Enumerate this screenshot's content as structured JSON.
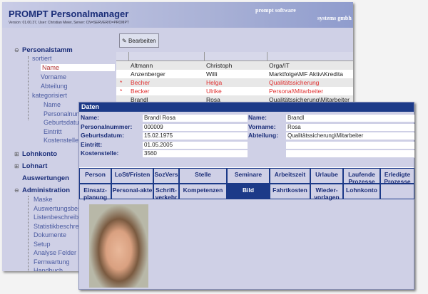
{
  "app": {
    "title": "PROMPT Personalmanager",
    "version": "Version: 01.00.37, User: Christian Meier, Server: CN=SERVER/O=PROMPT",
    "brand_top": "prompt software",
    "brand_bottom": "systems gmbh"
  },
  "sidebar": {
    "personalstamm": "Personalstamm",
    "sortiert": "sortiert",
    "sort_items": [
      "Name",
      "Vorname",
      "Abteilung"
    ],
    "kategorisiert": "kategorisiert",
    "kat_items": [
      "Name",
      "Personalnum",
      "Geburtsdatur",
      "Eintritt",
      "Kostenstelle"
    ],
    "lohnkonto": "Lohnkonto",
    "lohnart": "Lohnart",
    "auswertungen": "Auswertungen",
    "administration": "Administration",
    "admin_items": [
      "Maske",
      "Auswertungsbes",
      "Listenbeschreibu",
      "Statistikbeschreil",
      "Dokumente",
      "Setup",
      "Analyse Felder",
      "Fernwartung",
      "Handbuch"
    ]
  },
  "toolbar": {
    "edit_label": "Bearbeiten"
  },
  "list": {
    "rows": [
      {
        "star": "",
        "name": "Altmann",
        "vorname": "Christoph",
        "abteilung": "Orga/IT",
        "red": false
      },
      {
        "star": "",
        "name": "Anzenberger",
        "vorname": "Willi",
        "abteilung": "Marktfolge\\MF Aktiv\\Kredita",
        "red": false
      },
      {
        "star": "*",
        "name": "Becher",
        "vorname": "Helga",
        "abteilung": "Qualitätssicherung",
        "red": true
      },
      {
        "star": "*",
        "name": "Becker",
        "vorname": "Ulrike",
        "abteilung": "Personal\\Mitarbeiter",
        "red": true
      },
      {
        "star": "",
        "name": "Brandl",
        "vorname": "Rosa",
        "abteilung": "Qualitätssicherung\\Mitarbeiter",
        "red": false
      }
    ]
  },
  "dialog": {
    "title": "Daten",
    "left": [
      {
        "label": "Name:",
        "value": "Brandl Rosa"
      },
      {
        "label": "Personalnummer:",
        "value": "000009"
      },
      {
        "label": "Geburtsdatum:",
        "value": "15.02.1975"
      },
      {
        "label": "Eintritt:",
        "value": "01.05.2005"
      },
      {
        "label": "Kostenstelle:",
        "value": "3560"
      }
    ],
    "right": [
      {
        "label": "Name:",
        "value": "Brandl"
      },
      {
        "label": "Vorname:",
        "value": "Rosa"
      },
      {
        "label": "Abteilung:",
        "value": "Qualitätssicherung\\Mitarbeiter"
      },
      {
        "label": "",
        "value": ""
      },
      {
        "label": "",
        "value": ""
      }
    ],
    "tabs_row1": [
      "Person",
      "LoSt/Fristen",
      "SozVers",
      "Stelle",
      "Seminare",
      "Arbeitszeit",
      "Urlaube",
      "Laufende Prozesse",
      "Erledigte Prozesse"
    ],
    "tabs_row2": [
      "Einsatz-planung",
      "Personal-akte",
      "Schrift-verkehr",
      "Kompetenzen",
      "Bild",
      "Fahrtkosten",
      "Wieder-vorlagen",
      "Lohnkonto",
      ""
    ],
    "active_tab": "Bild"
  }
}
